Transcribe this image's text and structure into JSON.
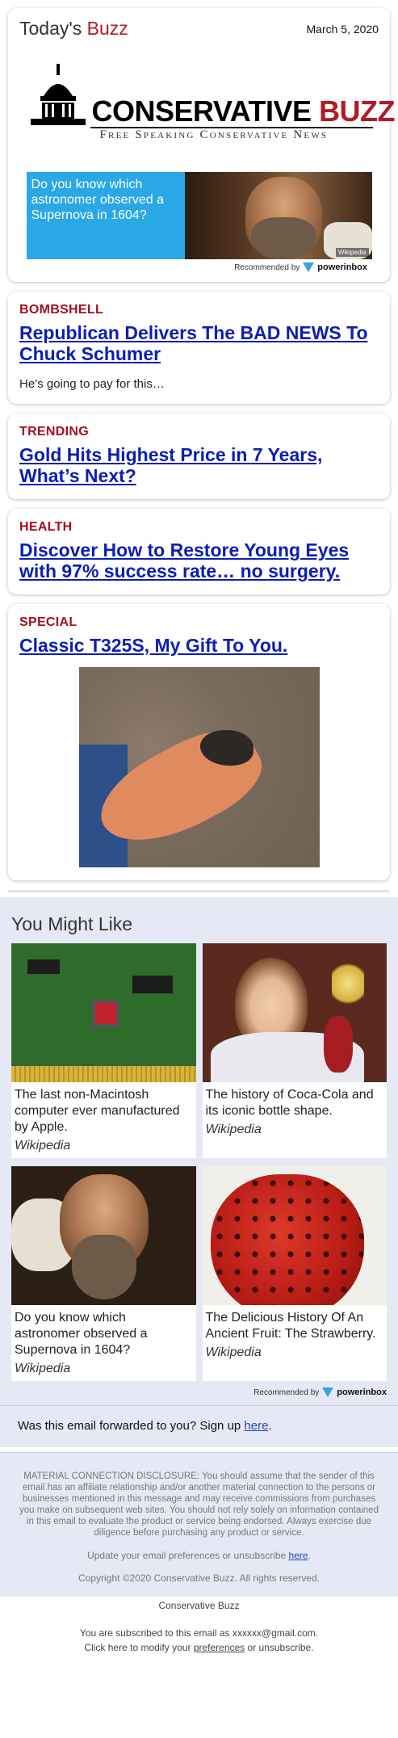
{
  "header": {
    "brand_a": "Today's ",
    "brand_b": "Buzz",
    "date": "March 5, 2020",
    "logo_main_a": "CONSERVATIVE ",
    "logo_main_b": "BUZZ",
    "logo_tagline": "Free Speaking Conservative News",
    "ad_text": "Do you know which astronomer observed a Supernova in 1604?",
    "ad_credit": "Wikipedia",
    "recommended_by": "Recommended by",
    "powerinbox": "powerinbox"
  },
  "stories": [
    {
      "kicker": "BOMBSHELL",
      "headline": "Republican Delivers The BAD NEWS To Chuck Schumer",
      "blurb": "He’s going to pay for this…"
    },
    {
      "kicker": "TRENDING",
      "headline": "Gold Hits Highest Price in 7 Years, What’s Next?"
    },
    {
      "kicker": "HEALTH",
      "headline": "Discover How to Restore Young Eyes with 97% success rate… no surgery."
    },
    {
      "kicker": "SPECIAL",
      "headline": "Classic T325S, My Gift To You."
    }
  ],
  "you_might_like": {
    "title": "You Might Like",
    "tiles": [
      {
        "caption": "The last non-Macintosh computer ever manufactured by Apple.",
        "source": "Wikipedia"
      },
      {
        "caption": "The history of Coca-Cola and its iconic bottle shape.",
        "source": "Wikipedia"
      },
      {
        "caption": "Do you know which astronomer observed a Supernova in 1604?",
        "source": "Wikipedia"
      },
      {
        "caption": "The Delicious History Of An Ancient Fruit: The Strawberry.",
        "source": "Wikipedia"
      }
    ],
    "recommended_by": "Recommended by",
    "powerinbox": "powerinbox"
  },
  "forward": {
    "text": "Was this email forwarded to you? Sign up ",
    "link": "here",
    "end": "."
  },
  "disclosure": {
    "text": "MATERIAL CONNECTION DISCLOSURE: You should assume that the sender of this email has an affiliate relationship and/or another material connection to the persons or businesses mentioned in this message and may receive commissions from purchases you make on subsequent web sites. You should not rely solely on information contained in this email to evaluate the product or service being endorsed. Always exercise due diligence before purchasing any product or service.",
    "update_text": "Update your email preferences or unsubscribe ",
    "update_link": "here",
    "update_end": ".",
    "copyright": "Copyright ©2020 Conservative Buzz. All rights reserved."
  },
  "footer": {
    "brand": "Conservative Buzz",
    "subscribed": "You are subscribed to this email as xxxxxx@gmail.com.",
    "modify_a": "Click here to modify your ",
    "modify_link": "preferences",
    "modify_b": " or unsubscribe."
  }
}
